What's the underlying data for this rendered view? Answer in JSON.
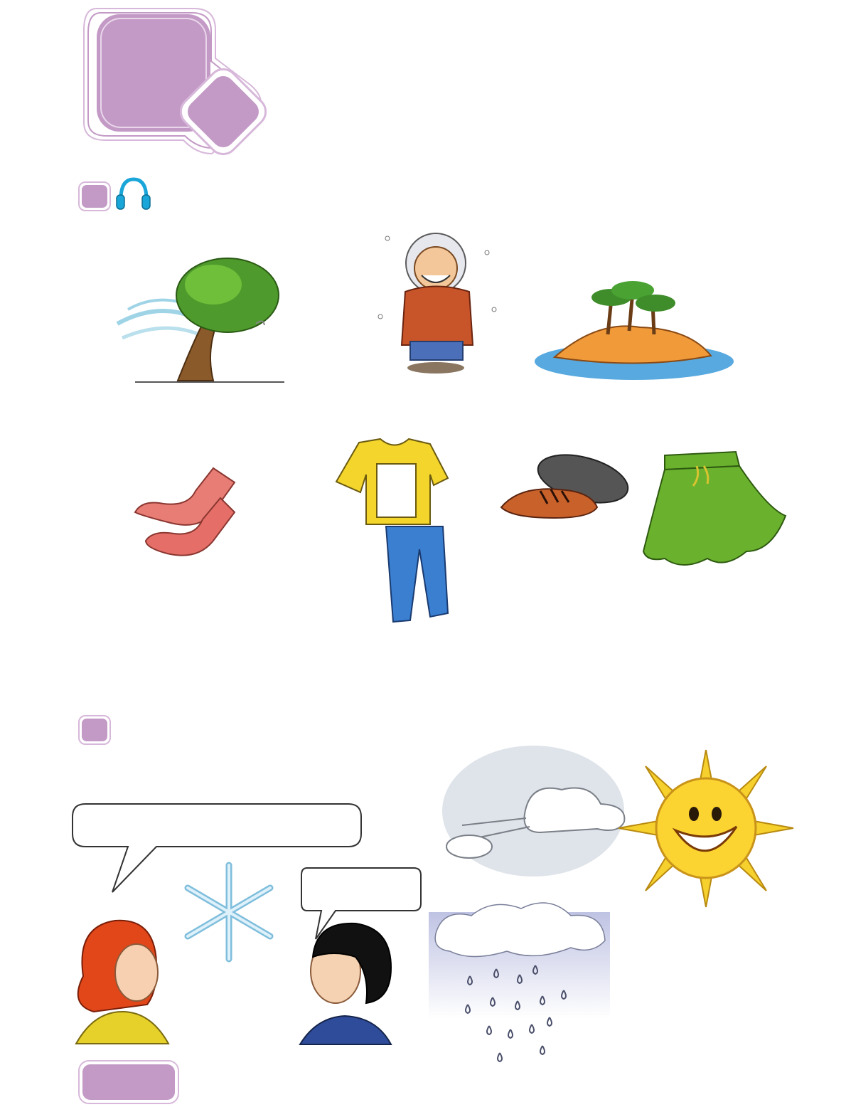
{
  "colors": {
    "accent_lilac": "#c39ac6",
    "accent_border": "#d7b8da",
    "headphone_blue": "#1aa6d9"
  },
  "header": {
    "unit_badge": {
      "large_shape": "rounded-square",
      "small_shape": "rotated-square",
      "icon": "unit-badge-icon"
    }
  },
  "section_1": {
    "number_box": "lilac-square",
    "icon": "headphones-icon",
    "row_1": [
      "windy-tree-icon",
      "freezing-man-icon",
      "tropical-island-icon"
    ],
    "row_2": [
      "socks-icon",
      "tshirt-and-jeans-icon",
      "shoes-icon",
      "skirt-icon"
    ]
  },
  "section_2": {
    "number_box": "lilac-square",
    "speech_bubbles": [
      "girl-speech-bubble",
      "boy-speech-bubble"
    ],
    "weather": [
      "snowflake-icon",
      "wind-cloud-icon",
      "sun-icon",
      "rain-cloud-icon"
    ],
    "characters": [
      "red-haired-girl",
      "dark-haired-boy"
    ]
  },
  "footer": {
    "page_tab": "lilac-rounded-tab"
  }
}
